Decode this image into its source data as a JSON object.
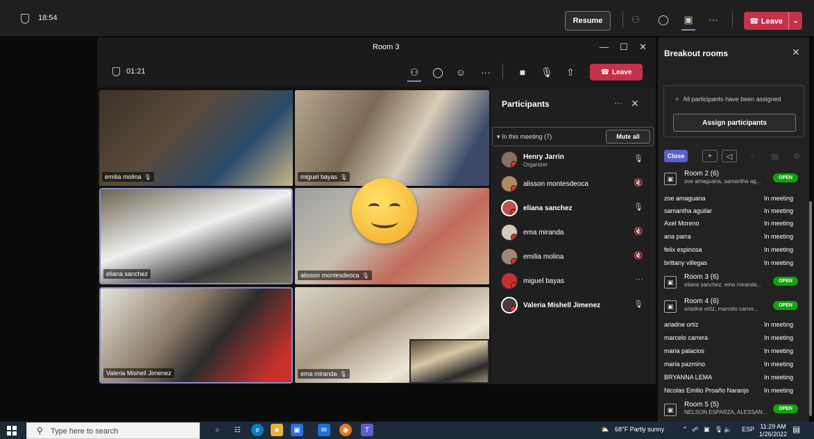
{
  "topbar": {
    "clock": "18:54",
    "resume_label": "Resume",
    "leave_label": "Leave"
  },
  "room_window": {
    "title": "Room 3",
    "clock": "01:21",
    "leave_label": "Leave"
  },
  "video_tiles": [
    {
      "name": "emilia molina"
    },
    {
      "name": "miguel bayas"
    },
    {
      "name": "eliana sanchez"
    },
    {
      "name": "alisson montesdeoca"
    },
    {
      "name": "Valeria Mishell Jimenez"
    },
    {
      "name": "ema miranda"
    }
  ],
  "participants": {
    "title": "Participants",
    "group_label": "In this meeting (7)",
    "mute_all_label": "Mute all",
    "people": [
      {
        "name": "Henry Jarrin",
        "role": "Organizer",
        "mic": "on"
      },
      {
        "name": "alisson montesdeoca",
        "mic": "muted"
      },
      {
        "name": "eliana sanchez",
        "mic": "on"
      },
      {
        "name": "ema miranda",
        "mic": "muted"
      },
      {
        "name": "emilia molina",
        "mic": "muted"
      },
      {
        "name": "miguel bayas",
        "mic": "more"
      },
      {
        "name": "Valeria Mishell Jimenez",
        "mic": "on"
      }
    ]
  },
  "breakout": {
    "title": "Breakout rooms",
    "assigned_note": "All participants have been assigned",
    "assign_label": "Assign participants",
    "close_label": "Close",
    "open_badge": "OPEN",
    "status_label": "In meeting",
    "room2": {
      "name": "Room 2 (6)",
      "members": "zoe amaguana, samantha ag..."
    },
    "room2_people": [
      "zoe amaguana",
      "samantha aguilar",
      "Axel Moreno",
      "ana parra",
      "felix espinosa",
      "brittany villegas"
    ],
    "room3": {
      "name": "Room 3 (6)",
      "members": "eliana sanchez, ema miranda..."
    },
    "room4": {
      "name": "Room 4 (6)",
      "members": "ariadne ortiz, marcelo carrer..."
    },
    "room4_people": [
      "ariadne ortiz",
      "marcelo carrera",
      "maria palacios",
      "maria pazmino",
      "BRYANNA LEMA",
      "Nicolas Emilio Proaño Naranjo"
    ],
    "room5": {
      "name": "Room 5 (5)",
      "members": "NELSON ESPARZA, ALESSAN..."
    }
  },
  "taskbar": {
    "search_placeholder": "Type here to search",
    "weather": "68°F  Partly sunny",
    "language": "ESP",
    "time": "11:29 AM",
    "date": "1/26/2022"
  },
  "colors": {
    "leave_red": "#c4314b",
    "accent_purple": "#5b5fc7",
    "open_green": "#13a10e",
    "muted_red_dot": "#d13438"
  }
}
